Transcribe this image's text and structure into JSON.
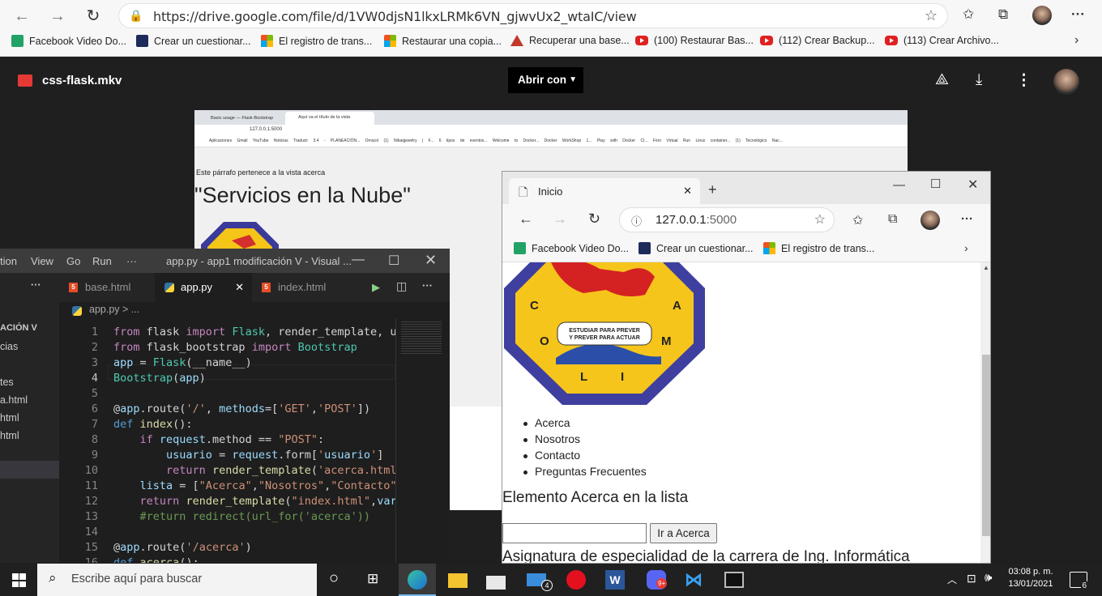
{
  "browser": {
    "url": "https://drive.google.com/file/d/1VW0djsN1lkxLRMk6VN_gjwvUx2_wtaIC/view",
    "bookmarks": [
      {
        "label": "Facebook Video Do...",
        "icon": "green-download-icon"
      },
      {
        "label": "Crear un cuestionar...",
        "icon": "navy-icon"
      },
      {
        "label": "El registro de trans...",
        "icon": "microsoft-icon"
      },
      {
        "label": "Restaurar una copia...",
        "icon": "microsoft-icon"
      },
      {
        "label": "Recuperar una base...",
        "icon": "triangle-icon"
      },
      {
        "label": "(100) Restaurar Bas...",
        "icon": "youtube-icon"
      },
      {
        "label": "(112) Crear Backup...",
        "icon": "youtube-icon"
      },
      {
        "label": "(113) Crear Archivo...",
        "icon": "youtube-icon"
      }
    ]
  },
  "drive": {
    "filename": "css-flask.mkv",
    "open_with": "Abrir con"
  },
  "video": {
    "tabs": [
      "Basic usage — Flask-Bootstrap",
      "Aquí va el título de la vista"
    ],
    "address": "127.0.0.1:5000",
    "bookmarks": "Aplicaciones  Gmail  YouTube  Noticias  Traducir  3.4 - PLANEACIÓN...  Orracol  (1) Nibaqjewelry | F...  6 tipos de eventos...  Welcome to Docker...  Docker WorkShop 1...  Play with Docker Cl...  Foro Virtual  Run Linux container...  (1) Tecnológico Nac...",
    "paragraph": "Este párrafo pertenece a la vista acerca",
    "heading": "\"Servicios en la Nube\""
  },
  "vscode": {
    "menu": [
      "tion",
      "View",
      "Go",
      "Run",
      "···"
    ],
    "title": "app.py - app1 modificación V - Visual ...",
    "sidebar": [
      "ACIÓN V",
      "cias",
      "tes",
      "a.html",
      "html",
      "html"
    ],
    "tabs": [
      "base.html",
      "app.py",
      "index.html"
    ],
    "breadcrumb": "app.py > ...",
    "lines": [
      {
        "n": "1",
        "t": "from flask import Flask, render_template, url_"
      },
      {
        "n": "2",
        "t": "from flask_bootstrap import Bootstrap"
      },
      {
        "n": "3",
        "t": "app = Flask(__name__)"
      },
      {
        "n": "4",
        "t": "Bootstrap(app)"
      },
      {
        "n": "5",
        "t": ""
      },
      {
        "n": "6",
        "t": "@app.route('/', methods=['GET','POST'])"
      },
      {
        "n": "7",
        "t": "def index():"
      },
      {
        "n": "8",
        "t": "    if request.method == \"POST\":"
      },
      {
        "n": "9",
        "t": "        usuario = request.form['usuario']"
      },
      {
        "n": "10",
        "t": "        return render_template('acerca.html',"
      },
      {
        "n": "11",
        "t": "    lista = [\"Acerca\",\"Nosotros\",\"Contacto\",\""
      },
      {
        "n": "12",
        "t": "    return render_template(\"index.html\",varia"
      },
      {
        "n": "13",
        "t": "    #return redirect(url_for('acerca'))"
      },
      {
        "n": "14",
        "t": ""
      },
      {
        "n": "15",
        "t": "@app.route('/acerca')"
      },
      {
        "n": "16",
        "t": "def acerca():"
      }
    ]
  },
  "edge2": {
    "tab": "Inicio",
    "address_gray": "127.0.0.1",
    "address_port": ":5000",
    "bookmarks": [
      "Facebook Video Do...",
      "Crear un cuestionar...",
      "El registro de trans..."
    ],
    "logo_text": "ESTUDIAR PARA PREVER Y PREVER PARA ACTUAR",
    "logo_letters": [
      "C",
      "A",
      "O",
      "M",
      "L",
      "I"
    ],
    "list": [
      "Acerca",
      "Nosotros",
      "Contacto",
      "Preguntas Frecuentes"
    ],
    "element_text": "Elemento Acerca en la lista",
    "button": "Ir a Acerca",
    "input_value": "",
    "subject": "Asignatura de especialidad de la carrera de Ing. Informática"
  },
  "taskbar": {
    "search_placeholder": "Escribe aquí para buscar",
    "time": "03:08 p. m.",
    "date": "13/01/2021",
    "mail_badge": "4",
    "discord_badge": "9+",
    "notification_count": "6"
  }
}
